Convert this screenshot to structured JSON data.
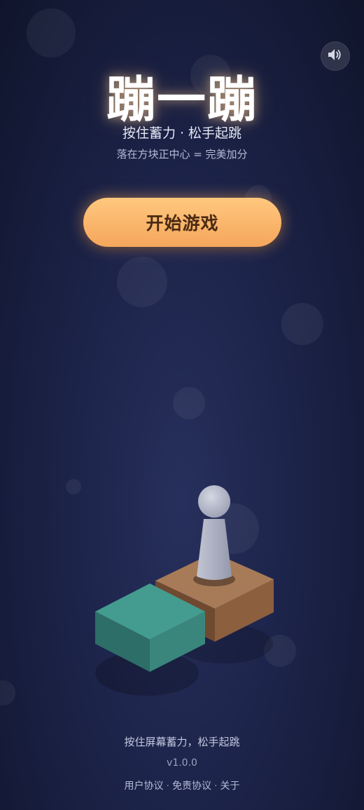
{
  "header": {
    "title": "蹦一蹦",
    "subtitle": "按住蓄力 · 松手起跳",
    "hint": "落在方块正中心 = 完美加分"
  },
  "sound": {
    "icon": "speaker-icon",
    "enabled": true
  },
  "start_button": {
    "label": "开始游戏"
  },
  "footer": {
    "hint": "按住屏幕蓄力，松手起跳",
    "version": "v1.0.0",
    "links": [
      "用户协议",
      "免责协议",
      "关于"
    ],
    "separator": "·"
  },
  "colors": {
    "background": "#1c2349",
    "button_top": "#ffc87e",
    "button_bottom": "#f5a65c",
    "button_text": "#4a2a12",
    "block_teal": "#3a8f86",
    "block_brown": "#9b6b47",
    "pawn": "#b8bccc"
  }
}
